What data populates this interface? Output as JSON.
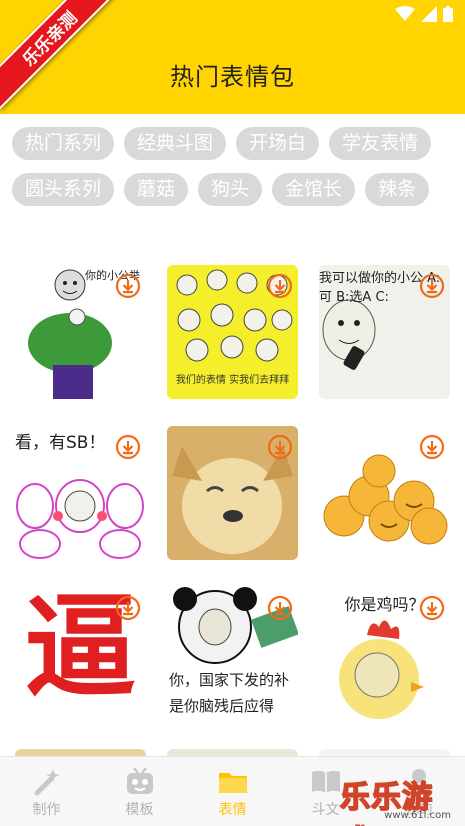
{
  "header": {
    "title": "热门表情包",
    "ribbon": "乐乐亲测",
    "background": "#ffd400"
  },
  "tags": [
    "热门系列",
    "经典斗图",
    "开场白",
    "学友表情",
    "圆头系列",
    "蘑菇",
    "狗头",
    "金馆长",
    "辣条"
  ],
  "stickers": [
    {
      "name": "hulk-meme",
      "caption": "你的小公举",
      "icon": "download-icon"
    },
    {
      "name": "faces-collage",
      "caption": "我们的表情 实我们去拜拜",
      "icon": "download-icon"
    },
    {
      "name": "quiz-meme",
      "caption": "我可以做你的小公 A:可 B:选A C:",
      "icon": "download-icon"
    },
    {
      "name": "rabbit-meme",
      "caption": "看，有SB！",
      "icon": "download-icon"
    },
    {
      "name": "doge-meme",
      "caption": "",
      "icon": "download-icon"
    },
    {
      "name": "smiley-stack-meme",
      "caption": "",
      "icon": "download-icon"
    },
    {
      "name": "bi-character-meme",
      "caption": "逼",
      "icon": "download-icon"
    },
    {
      "name": "panda-money-meme",
      "caption": "你，国家下发的补 是你脑残后应得",
      "icon": "download-icon"
    },
    {
      "name": "chicken-meme",
      "caption": "你是鸡吗？",
      "icon": "download-icon"
    }
  ],
  "tabbar": {
    "tabs": [
      {
        "label": "制作",
        "icon": "wand-icon",
        "active": false
      },
      {
        "label": "模板",
        "icon": "robot-icon",
        "active": false
      },
      {
        "label": "表情",
        "icon": "folder-icon",
        "active": true
      },
      {
        "label": "斗文",
        "icon": "book-icon",
        "active": false
      },
      {
        "label": "我的",
        "icon": "user-icon",
        "active": false
      }
    ]
  },
  "watermark": {
    "text": "乐乐游戏",
    "url": "www.61l.com"
  },
  "colors": {
    "accent": "#ffc400",
    "download": "#f06a1a",
    "tag_bg": "#d9d9d9"
  }
}
